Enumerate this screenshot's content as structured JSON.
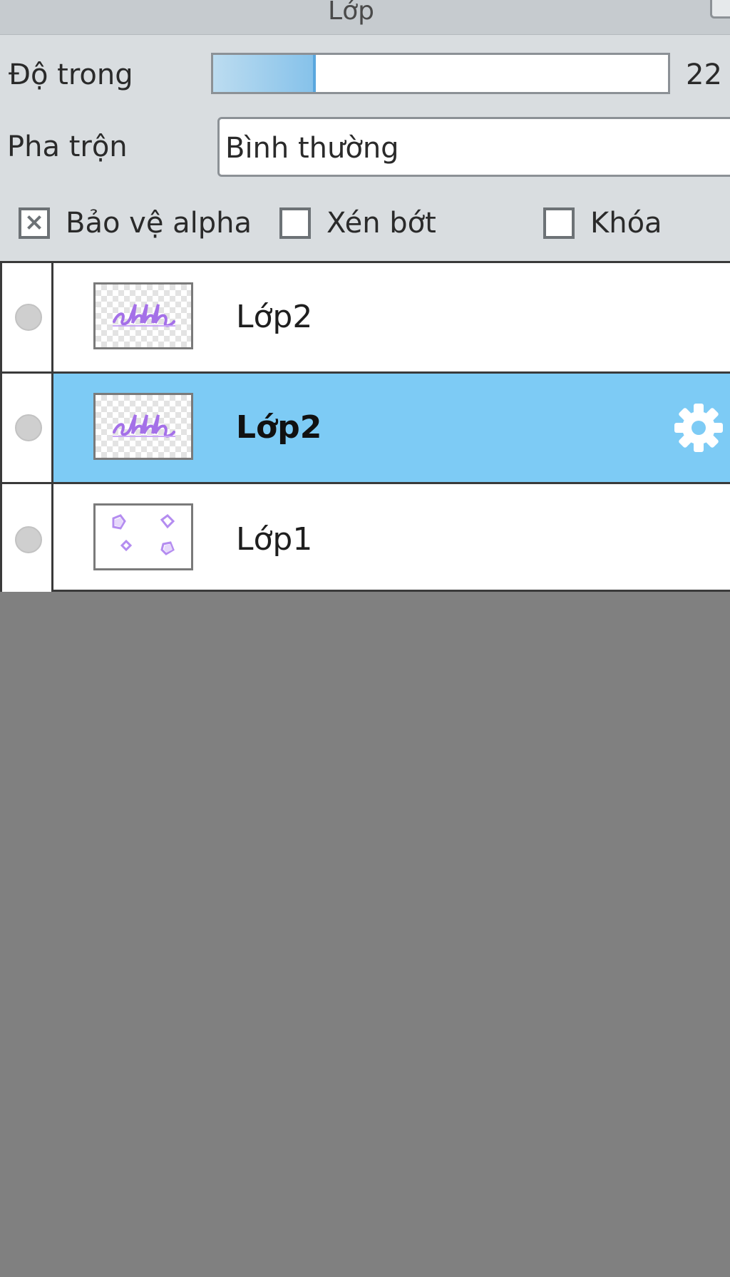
{
  "panel": {
    "title": "Lớp"
  },
  "opacity": {
    "label": "Độ trong",
    "value_text": "22",
    "fill_fraction": 0.22
  },
  "blend": {
    "label": "Pha trộn",
    "selected": "Bình thường"
  },
  "options": [
    {
      "label": "Bảo vệ alpha",
      "checked": true
    },
    {
      "label": "Xén bớt",
      "checked": false
    },
    {
      "label": "Khóa",
      "checked": false
    }
  ],
  "layers": [
    {
      "name": "Lớp2",
      "selected": false,
      "thumbnail": "text-sketch"
    },
    {
      "name": "Lớp2",
      "selected": true,
      "thumbnail": "text-sketch",
      "action_icon": "gear-icon"
    },
    {
      "name": "Lớp1",
      "selected": false,
      "thumbnail": "shapes-sketch"
    }
  ],
  "colors": {
    "selected_row": "#7dcbf5",
    "slider_fill": "#86c2ea",
    "thumbnail_ink": "#a470e8",
    "empty_area": "#808080"
  },
  "icons": {
    "visibility": "visibility-dot-icon",
    "settings": "gear-icon"
  }
}
